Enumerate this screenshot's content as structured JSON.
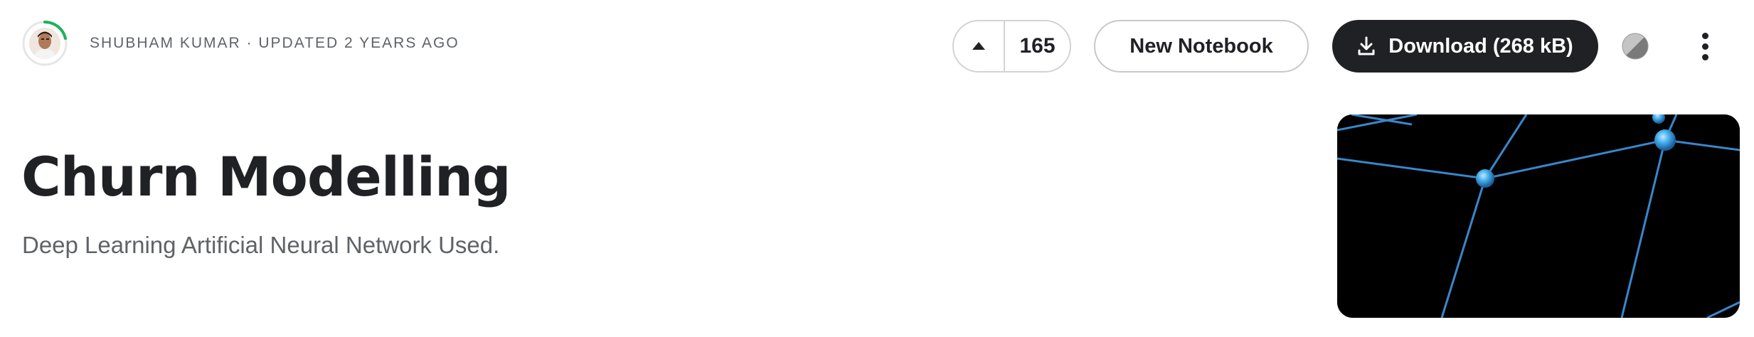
{
  "header": {
    "author": "SHUBHAM KUMAR",
    "separator": "·",
    "updated": "UPDATED 2 YEARS AGO",
    "upvote_count": "165",
    "new_notebook_label": "New Notebook",
    "download_label": "Download (268 kB)",
    "icons": [
      "avatar",
      "upvote-arrow-icon",
      "download-icon",
      "theme-toggle-icon",
      "more-vert-icon"
    ]
  },
  "dataset": {
    "title": "Churn Modelling",
    "subtitle": "Deep Learning Artificial Neural Network Used."
  },
  "colors": {
    "dark_button": "#202124",
    "muted_text": "#5f6368",
    "border": "#d3d3d3",
    "avatar_ring": "#20b15a",
    "cover_lines": "#3c8fd6",
    "cover_nodes": "#4ab1f0"
  }
}
